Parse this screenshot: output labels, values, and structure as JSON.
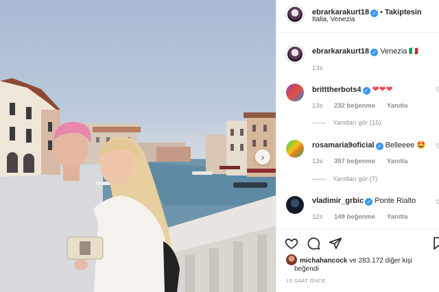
{
  "post": {
    "owner": "ebrarkarakurt18",
    "follow_dot": "•",
    "follow_label": "Takiptesin",
    "location": "Italia, Venezia"
  },
  "caption": {
    "user": "ebrarkarakurt18",
    "text": "Venezia 🇮🇹",
    "time": "13s"
  },
  "comments": [
    {
      "user": "britttherbots4",
      "text": "❤❤❤",
      "time": "13s",
      "likes": "232 beğenme",
      "reply": "Yanıtla",
      "view_replies": "Yanıtları gör (15)"
    },
    {
      "user": "rosamaria9oficial",
      "text": "Belleeee 🤩",
      "time": "13s",
      "likes": "357 beğenme",
      "reply": "Yanıtla",
      "view_replies": "Yanıtları gör (7)"
    },
    {
      "user": "vladimir_grbic",
      "text": "Ponte Rialto",
      "time": "12s",
      "likes": "149 beğenme",
      "reply": "Yanıtla"
    }
  ],
  "likes_summary": {
    "user": "michahancock",
    "rest": "ve 283.172 diğer kişi",
    "line2": "beğendi"
  },
  "timestamp": "13 SAAT ÖNCE",
  "icons": {
    "verified": "✓",
    "next": "›",
    "heart_outline": "♡"
  }
}
